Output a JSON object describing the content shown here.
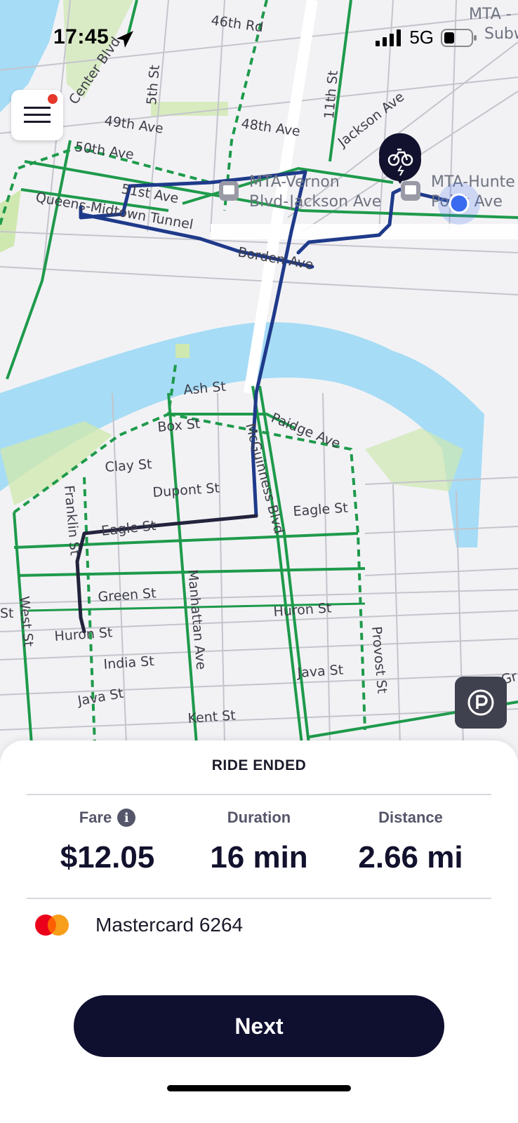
{
  "status_bar": {
    "time": "17:45",
    "network": "5G"
  },
  "map": {
    "streets": [
      "46th Rd",
      "Center Blvd",
      "5th St",
      "11th St",
      "49th Ave",
      "48th Ave",
      "50th Ave",
      "Jackson Ave",
      "51st Ave",
      "Queens-Midtown Tunnel",
      "Borden Ave",
      "Ash St",
      "Box St",
      "Paidge Ave",
      "Clay St",
      "Dupont St",
      "McGuinness Blvd",
      "Eagle St",
      "Eagle St",
      "Franklin St",
      "West St",
      "Green St",
      "Manhattan Ave",
      "Huron St",
      "Huron St",
      "India St",
      "Java St",
      "Java St",
      "Provost St",
      "Kent St",
      "St",
      "Gr"
    ],
    "pois": [
      {
        "line1": "MTA-Vernon",
        "line2": "Blvd-Jackson Ave"
      },
      {
        "line1": "MTA-Hunte",
        "line2": "Point Ave"
      },
      {
        "line1": "MTA -",
        "line2": "Subw"
      }
    ]
  },
  "ride": {
    "title": "RIDE ENDED",
    "fare_label": "Fare",
    "fare_value": "$12.05",
    "duration_label": "Duration",
    "duration_value": "16 min",
    "distance_label": "Distance",
    "distance_value": "2.66 mi",
    "payment_method": "Mastercard 6264",
    "next_label": "Next"
  },
  "colors": {
    "bike_lane": "#1e9a4b",
    "route": "#1f3a8a",
    "water": "#a6dcf5",
    "park": "#cfe8b0",
    "accent_dark": "#0f0f30"
  },
  "icons": [
    "navigation-arrow-icon",
    "signal-bars-icon",
    "battery-icon",
    "hamburger-menu-icon",
    "bike-station-icon",
    "bus-stop-icon",
    "current-location-icon",
    "parking-icon",
    "info-icon",
    "mastercard-icon"
  ]
}
